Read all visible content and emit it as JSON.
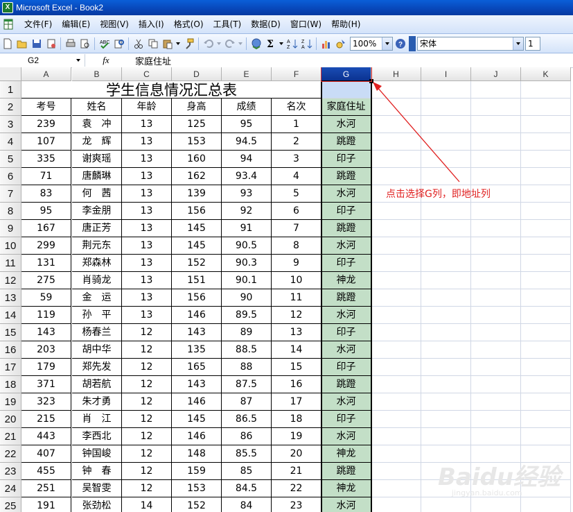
{
  "window": {
    "title": "Microsoft Excel - Book2",
    "app_icon_letter": "X"
  },
  "menu": [
    "文件(F)",
    "编辑(E)",
    "视图(V)",
    "插入(I)",
    "格式(O)",
    "工具(T)",
    "数据(D)",
    "窗口(W)",
    "帮助(H)"
  ],
  "toolbar": {
    "zoom": "100%",
    "font_name": "宋体",
    "font_size": "1",
    "icons": [
      "new-icon",
      "open-icon",
      "save-icon",
      "permission-icon",
      "print-icon",
      "print-preview-icon",
      "spelling-icon",
      "research-icon",
      "cut-icon",
      "copy-icon",
      "paste-icon",
      "format-painter-icon",
      "undo-icon",
      "redo-icon",
      "hyperlink-icon",
      "autosum-icon",
      "sort-ascending-icon",
      "sort-descending-icon",
      "chart-wizard-icon",
      "drawing-icon",
      "help-icon"
    ]
  },
  "formula_bar": {
    "name_box": "G2",
    "fx_label": "fx",
    "content": "家庭住址"
  },
  "sheet": {
    "columns": [
      "A",
      "B",
      "C",
      "D",
      "E",
      "F",
      "G",
      "H",
      "I",
      "J",
      "K"
    ],
    "selected_column": "G",
    "title": "学生信息情况汇总表",
    "headers": [
      "考号",
      "姓名",
      "年龄",
      "身高",
      "成绩",
      "名次",
      "家庭住址"
    ],
    "rows": [
      [
        "239",
        "袁　冲",
        "13",
        "125",
        "95",
        "1",
        "水河"
      ],
      [
        "107",
        "龙　辉",
        "13",
        "153",
        "94.5",
        "2",
        "跳蹬"
      ],
      [
        "335",
        "谢爽瑶",
        "13",
        "160",
        "94",
        "3",
        "印子"
      ],
      [
        "71",
        "唐麟琳",
        "13",
        "162",
        "93.4",
        "4",
        "跳蹬"
      ],
      [
        "83",
        "何　茜",
        "13",
        "139",
        "93",
        "5",
        "水河"
      ],
      [
        "95",
        "李金朋",
        "13",
        "156",
        "92",
        "6",
        "印子"
      ],
      [
        "167",
        "唐正芳",
        "13",
        "145",
        "91",
        "7",
        "跳蹬"
      ],
      [
        "299",
        "荆元东",
        "13",
        "145",
        "90.5",
        "8",
        "水河"
      ],
      [
        "131",
        "郑森林",
        "13",
        "152",
        "90.3",
        "9",
        "印子"
      ],
      [
        "275",
        "肖骑龙",
        "13",
        "151",
        "90.1",
        "10",
        "神龙"
      ],
      [
        "59",
        "金　运",
        "13",
        "156",
        "90",
        "11",
        "跳蹬"
      ],
      [
        "119",
        "孙　平",
        "13",
        "146",
        "89.5",
        "12",
        "水河"
      ],
      [
        "143",
        "杨春兰",
        "12",
        "143",
        "89",
        "13",
        "印子"
      ],
      [
        "203",
        "胡中华",
        "12",
        "135",
        "88.5",
        "14",
        "水河"
      ],
      [
        "179",
        "郑先发",
        "12",
        "165",
        "88",
        "15",
        "印子"
      ],
      [
        "371",
        "胡若航",
        "12",
        "143",
        "87.5",
        "16",
        "跳蹬"
      ],
      [
        "323",
        "朱才勇",
        "12",
        "146",
        "87",
        "17",
        "水河"
      ],
      [
        "215",
        "肖　江",
        "12",
        "145",
        "86.5",
        "18",
        "印子"
      ],
      [
        "443",
        "李西北",
        "12",
        "146",
        "86",
        "19",
        "水河"
      ],
      [
        "407",
        "钟国峻",
        "12",
        "148",
        "85.5",
        "20",
        "神龙"
      ],
      [
        "455",
        "钟　春",
        "12",
        "159",
        "85",
        "21",
        "跳蹬"
      ],
      [
        "251",
        "吴智雯",
        "12",
        "153",
        "84.5",
        "22",
        "神龙"
      ],
      [
        "191",
        "张劲松",
        "14",
        "152",
        "84",
        "23",
        "水河"
      ]
    ],
    "row_numbers": [
      "1",
      "2",
      "3",
      "4",
      "5",
      "6",
      "7",
      "8",
      "9",
      "10",
      "11",
      "12",
      "13",
      "14",
      "15",
      "16",
      "17",
      "18",
      "19",
      "20",
      "21",
      "22",
      "23",
      "24",
      "25"
    ]
  },
  "annotation": {
    "text": "点击选择G列，即地址列",
    "color": "#e02020"
  },
  "watermark": {
    "text": "Baidu经验",
    "subtext": "jingyan.baidu.com"
  }
}
